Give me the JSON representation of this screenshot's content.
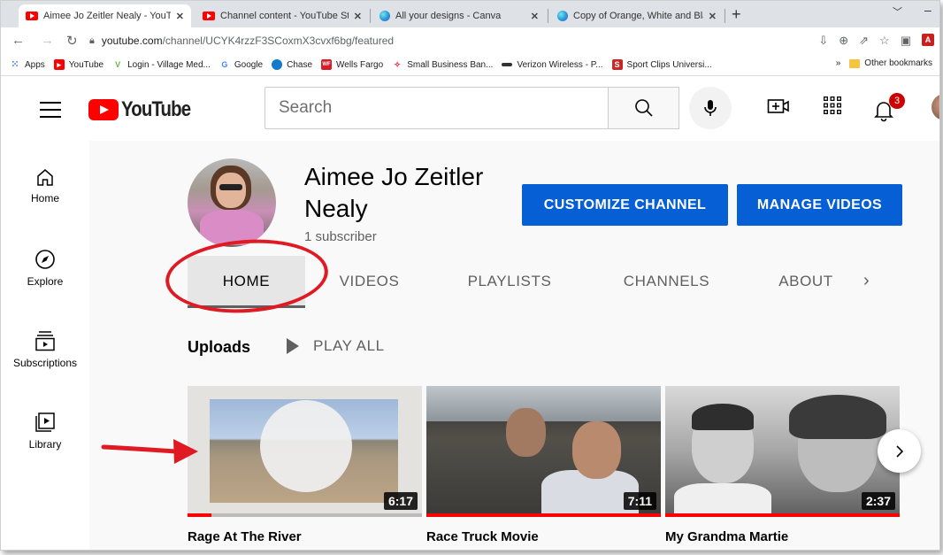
{
  "browser": {
    "tabs": [
      {
        "label": "Aimee Jo Zeitler Nealy - YouTube",
        "icon": "youtube-icon",
        "active": true
      },
      {
        "label": "Channel content - YouTube Studio",
        "icon": "youtube-icon",
        "active": false
      },
      {
        "label": "All your designs - Canva",
        "icon": "canva-icon",
        "active": false
      },
      {
        "label": "Copy of Orange, White and Black",
        "icon": "canva-icon",
        "active": false
      }
    ],
    "url_host": "youtube.com",
    "url_path": "/channel/UCYK4rzzF3SCoxmX3cvxf6bg/featured",
    "bookmarks": [
      {
        "label": "Apps",
        "icon": "apps-grid-icon",
        "color": "#1a73e8"
      },
      {
        "label": "YouTube",
        "icon": "youtube-icon",
        "color": "#ff0000"
      },
      {
        "label": "Login - Village Med...",
        "icon": "village-med-icon",
        "color": "#4caf50"
      },
      {
        "label": "Google",
        "icon": "google-icon",
        "color": "#4285f4"
      },
      {
        "label": "Chase",
        "icon": "chase-icon",
        "color": "#117aca"
      },
      {
        "label": "Wells Fargo",
        "icon": "wells-fargo-icon",
        "color": "#d71e28"
      },
      {
        "label": "Small Business Ban...",
        "icon": "bank-icon",
        "color": "#e31837"
      },
      {
        "label": "Verizon Wireless - P...",
        "icon": "verizon-icon",
        "color": "#333333"
      },
      {
        "label": "Sport Clips Universi...",
        "icon": "sport-clips-icon",
        "color": "#c62828"
      }
    ],
    "bookmarks_overflow": "»",
    "other_bookmarks": "Other bookmarks"
  },
  "youtube": {
    "logo_text": "YouTube",
    "search_placeholder": "Search",
    "notification_count": "3",
    "sidebar": [
      {
        "label": "Home",
        "icon": "home-icon"
      },
      {
        "label": "Explore",
        "icon": "compass-icon"
      },
      {
        "label": "Subscriptions",
        "icon": "subscriptions-icon"
      },
      {
        "label": "Library",
        "icon": "library-icon"
      }
    ]
  },
  "channel": {
    "name": "Aimee Jo Zeitler Nealy",
    "subscribers": "1 subscriber",
    "customize_label": "CUSTOMIZE CHANNEL",
    "manage_label": "MANAGE VIDEOS",
    "tabs": [
      "HOME",
      "VIDEOS",
      "PLAYLISTS",
      "CHANNELS",
      "ABOUT"
    ],
    "selected_tab": "HOME"
  },
  "uploads": {
    "heading": "Uploads",
    "play_all": "PLAY ALL",
    "videos": [
      {
        "title": "Rage At The River",
        "duration": "6:17",
        "watched_fraction": 0.1
      },
      {
        "title": "Race Truck Movie",
        "duration": "7:11",
        "watched_fraction": 1.0
      },
      {
        "title": "My Grandma Martie",
        "duration": "2:37",
        "watched_fraction": 1.0
      }
    ]
  },
  "colors": {
    "youtube_red": "#ff0000",
    "button_blue": "#065fd4",
    "annotation_red": "#e01a22"
  }
}
